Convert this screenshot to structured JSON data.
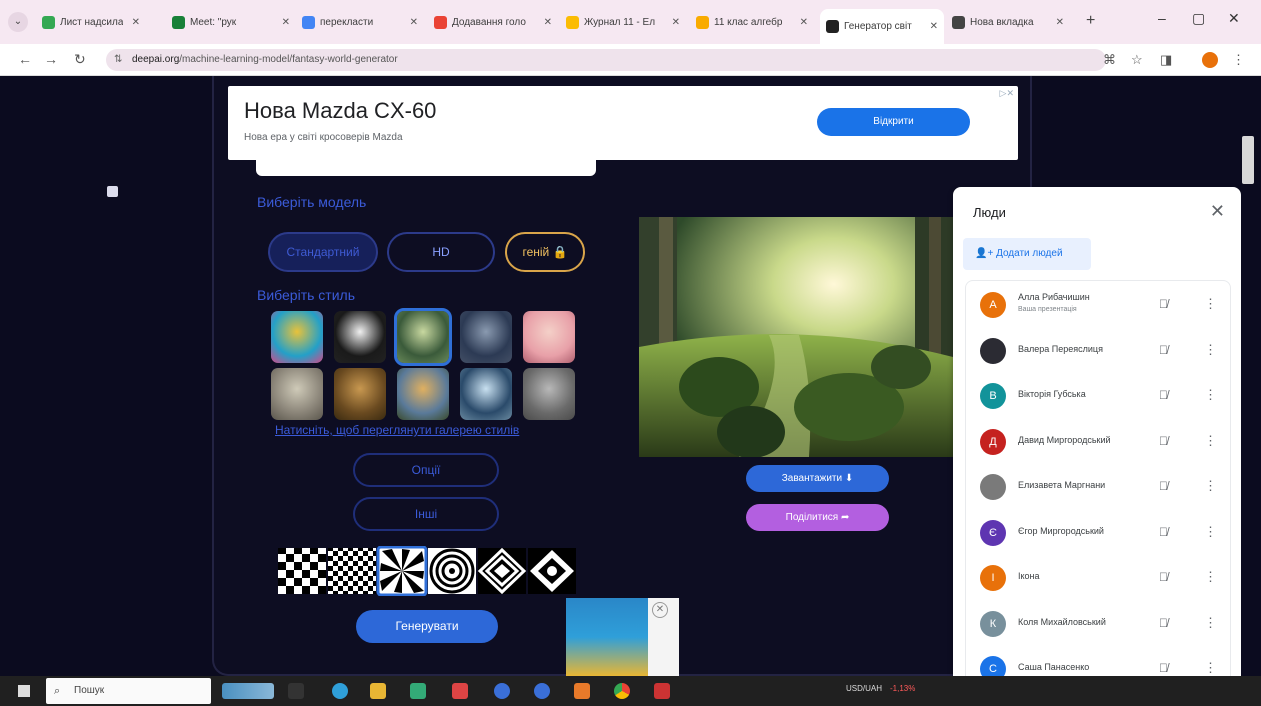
{
  "browser": {
    "tabs": [
      {
        "label": "Лист надсилан",
        "color": "#34a853"
      },
      {
        "label": "Meet: \"рук",
        "color": "#188038"
      },
      {
        "label": "перекласти",
        "color": "#4285f4"
      },
      {
        "label": "Додавання голо",
        "color": "#ea4335"
      },
      {
        "label": "Журнал 11 - Ел",
        "color": "#fbbc04"
      },
      {
        "label": "11 клас алгебр",
        "color": "#f9ab00"
      },
      {
        "label": "Генератор світ",
        "color": "#222222"
      },
      {
        "label": "Нова вкладка",
        "color": "#444444"
      }
    ],
    "active_tab_index": 6,
    "url_domain": "deepai.org",
    "url_path": "/machine-learning-model/fantasy-world-generator"
  },
  "ad": {
    "title": "Нова Mazda CX-60",
    "subtitle": "Нова ера у світі кросоверів Mazda",
    "button": "Відкрити"
  },
  "generator": {
    "model_label": "Виберіть модель",
    "models": [
      "Стандартний",
      "HD",
      "геній 🔒"
    ],
    "selected_model": "Стандартний",
    "style_label": "Виберіть стиль",
    "style_link": "Натисніть, щоб переглянути галерею стилів",
    "options_button": "Опції",
    "more_button": "Інші",
    "generate_button": "Генерувати",
    "download_button": "Завантажити ⬇",
    "share_button": "Поділитися ➦"
  },
  "people_panel": {
    "title": "Люди",
    "add_people": "Додати людей",
    "participants": [
      {
        "name": "Алла Рибачишин",
        "sub": "Ваша презентація",
        "initial": "А",
        "color": "#e8710a"
      },
      {
        "name": "Валера Переяслиця",
        "sub": "",
        "initial": "",
        "color": "#2b2b33"
      },
      {
        "name": "Вікторія Губська",
        "sub": "",
        "initial": "В",
        "color": "#12939a"
      },
      {
        "name": "Давид Миргородський",
        "sub": "",
        "initial": "Д",
        "color": "#c5221f"
      },
      {
        "name": "Елизавета Маргнани",
        "sub": "",
        "initial": "",
        "color": "#7a7a7a"
      },
      {
        "name": "Єгор Миргородський",
        "sub": "",
        "initial": "Є",
        "color": "#5e35b1"
      },
      {
        "name": "Ікона",
        "sub": "",
        "initial": "І",
        "color": "#e8710a"
      },
      {
        "name": "Коля Михайловський",
        "sub": "",
        "initial": "К",
        "color": "#78909c"
      },
      {
        "name": "Саша Панасенко",
        "sub": "",
        "initial": "С",
        "color": "#1a73e8"
      }
    ]
  },
  "taskbar": {
    "search_placeholder": "Пошук",
    "currency": "USD/UAH",
    "change": "-1,13%"
  }
}
